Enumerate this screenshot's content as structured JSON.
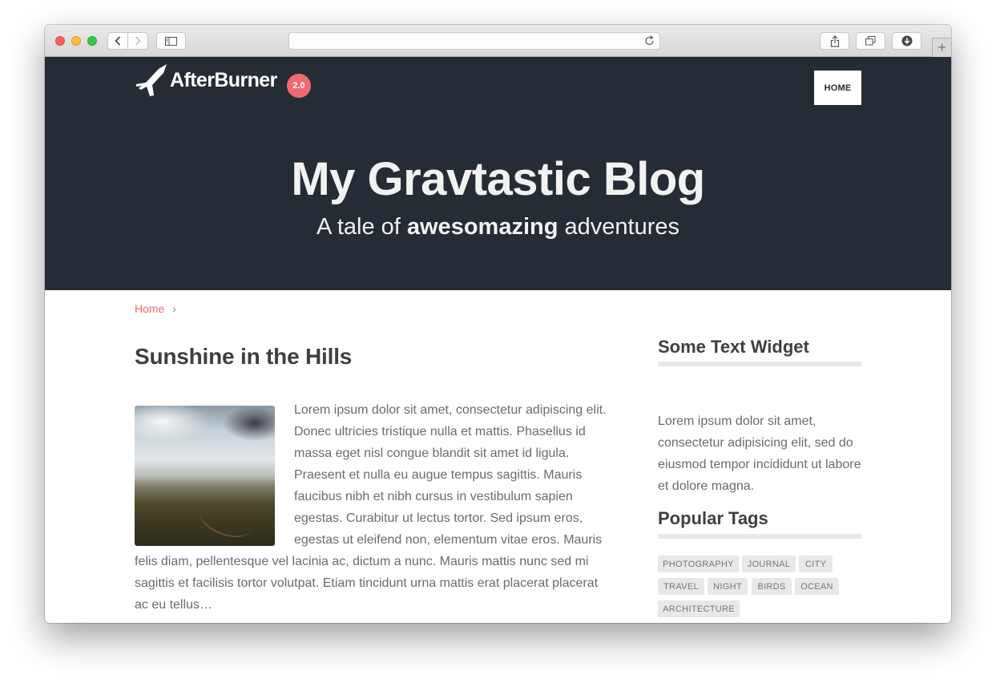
{
  "browser": {
    "url": "",
    "new_tab": "+"
  },
  "header": {
    "logo_text": "AfterBurner",
    "version": "2.0",
    "nav": [
      "HOME"
    ]
  },
  "hero": {
    "title": "My Gravtastic Blog",
    "subtitle_prefix": "A tale of ",
    "subtitle_bold": "awesomazing",
    "subtitle_suffix": " adventures"
  },
  "breadcrumb": {
    "home": "Home",
    "separator": "›"
  },
  "post": {
    "title": "Sunshine in the Hills",
    "body": "Lorem ipsum dolor sit amet, consectetur adipiscing elit. Donec ultricies tristique nulla et mattis. Phasellus id massa eget nisl congue blandit sit amet id ligula. Praesent et nulla eu augue tempus sagittis. Mauris faucibus nibh et nibh cursus in vestibulum sapien egestas. Curabitur ut lectus tortor. Sed ipsum eros, egestas ut eleifend non, elementum vitae eros. Mauris felis diam, pellentesque vel lacinia ac, dictum a nunc. Mauris mattis nunc sed mi sagittis et facilisis tortor volutpat. Etiam tincidunt urna mattis erat placerat placerat ac eu tellus…"
  },
  "sidebar": {
    "text_widget": {
      "title": "Some Text Widget",
      "text": "Lorem ipsum dolor sit amet, consectetur adipisicing elit, sed do eiusmod tempor incididunt ut labore et dolore magna."
    },
    "tags_widget": {
      "title": "Popular Tags",
      "tags": [
        "PHOTOGRAPHY",
        "JOURNAL",
        "CITY",
        "TRAVEL",
        "NIGHT",
        "BIRDS",
        "OCEAN",
        "ARCHITECTURE"
      ]
    }
  },
  "colors": {
    "hero_bg": "#262c36",
    "accent": "#ef6a6f"
  }
}
